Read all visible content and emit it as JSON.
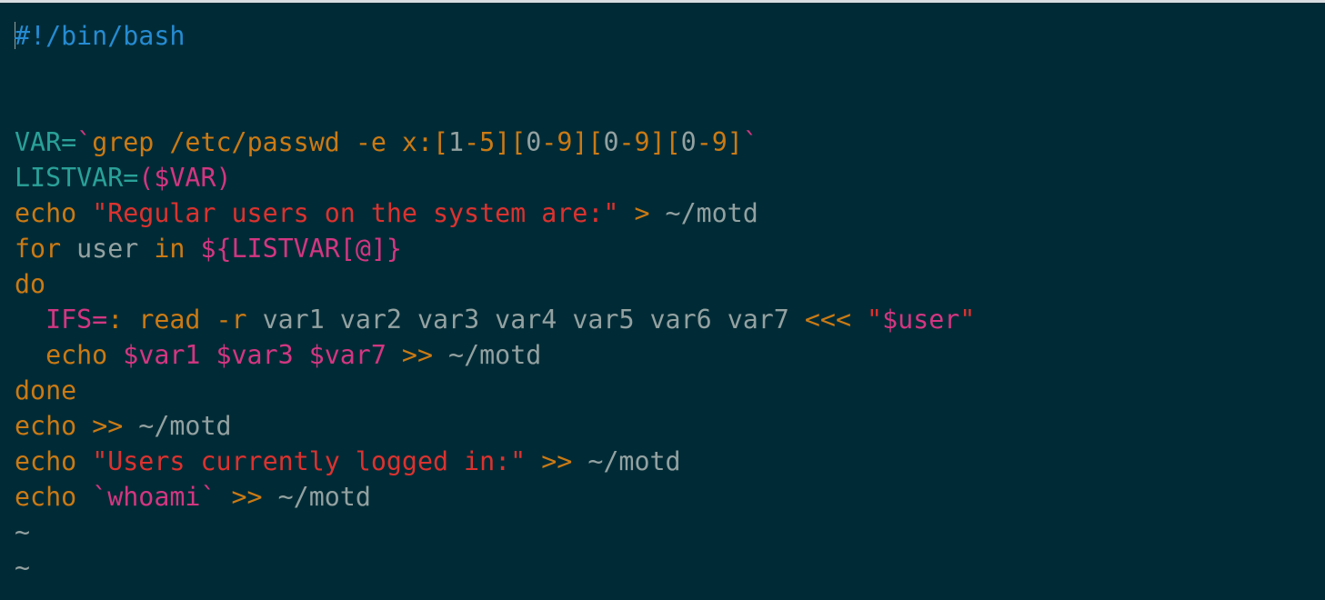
{
  "colors": {
    "background": "#002b36",
    "default": "#93a1a1",
    "cyan": "#2aa198",
    "blue": "#268bd2",
    "orange": "#cb7a14",
    "red": "#dc322f",
    "magenta": "#d33682",
    "tilde": "#93a1a1"
  },
  "editor": {
    "lines": [
      {
        "tokens": [
          {
            "t": "#!/bin/bash",
            "c": "blue"
          }
        ]
      },
      {
        "tokens": []
      },
      {
        "tokens": []
      },
      {
        "tokens": [
          {
            "t": "VAR=",
            "c": "cyan"
          },
          {
            "t": "`",
            "c": "magenta"
          },
          {
            "t": "grep /etc/passwd -e x:",
            "c": "orange"
          },
          {
            "t": "[",
            "c": "orange"
          },
          {
            "t": "1",
            "c": "default"
          },
          {
            "t": "-5][",
            "c": "orange"
          },
          {
            "t": "0",
            "c": "default"
          },
          {
            "t": "-9][",
            "c": "orange"
          },
          {
            "t": "0",
            "c": "default"
          },
          {
            "t": "-9][",
            "c": "orange"
          },
          {
            "t": "0",
            "c": "default"
          },
          {
            "t": "-9]",
            "c": "orange"
          },
          {
            "t": "`",
            "c": "magenta"
          }
        ]
      },
      {
        "tokens": [
          {
            "t": "LISTVAR=",
            "c": "cyan"
          },
          {
            "t": "($VAR)",
            "c": "magenta"
          }
        ]
      },
      {
        "tokens": [
          {
            "t": "echo ",
            "c": "orange"
          },
          {
            "t": "\"Regular users on the system are:\"",
            "c": "red"
          },
          {
            "t": " > ",
            "c": "orange"
          },
          {
            "t": "~/motd",
            "c": "default"
          }
        ]
      },
      {
        "tokens": [
          {
            "t": "for",
            "c": "orange"
          },
          {
            "t": " user ",
            "c": "default"
          },
          {
            "t": "in",
            "c": "orange"
          },
          {
            "t": " ",
            "c": "default"
          },
          {
            "t": "${LISTVAR[@]}",
            "c": "magenta"
          }
        ]
      },
      {
        "tokens": [
          {
            "t": "do",
            "c": "orange"
          }
        ]
      },
      {
        "tokens": [
          {
            "t": "  ",
            "c": "default"
          },
          {
            "t": "IFS=",
            "c": "magenta"
          },
          {
            "t": ": ",
            "c": "orange"
          },
          {
            "t": "read -r",
            "c": "orange"
          },
          {
            "t": " var1 var2 var3 var4 var5 var6 var7 ",
            "c": "default"
          },
          {
            "t": "<<< ",
            "c": "orange"
          },
          {
            "t": "\"",
            "c": "red"
          },
          {
            "t": "$user",
            "c": "magenta"
          },
          {
            "t": "\"",
            "c": "red"
          }
        ]
      },
      {
        "tokens": [
          {
            "t": "  ",
            "c": "default"
          },
          {
            "t": "echo ",
            "c": "orange"
          },
          {
            "t": "$var1 $var3 $var7",
            "c": "magenta"
          },
          {
            "t": " >> ",
            "c": "orange"
          },
          {
            "t": "~/motd",
            "c": "default"
          }
        ]
      },
      {
        "tokens": [
          {
            "t": "done",
            "c": "orange"
          }
        ]
      },
      {
        "tokens": [
          {
            "t": "echo ",
            "c": "orange"
          },
          {
            "t": ">> ",
            "c": "orange"
          },
          {
            "t": "~/motd",
            "c": "default"
          }
        ]
      },
      {
        "tokens": [
          {
            "t": "echo ",
            "c": "orange"
          },
          {
            "t": "\"Users currently logged in:\"",
            "c": "red"
          },
          {
            "t": " >> ",
            "c": "orange"
          },
          {
            "t": "~/motd",
            "c": "default"
          }
        ]
      },
      {
        "tokens": [
          {
            "t": "echo ",
            "c": "orange"
          },
          {
            "t": "`whoami`",
            "c": "magenta"
          },
          {
            "t": " >> ",
            "c": "orange"
          },
          {
            "t": "~/motd",
            "c": "default"
          }
        ]
      },
      {
        "tokens": [
          {
            "t": "~",
            "c": "tilde"
          }
        ]
      },
      {
        "tokens": [
          {
            "t": "~",
            "c": "tilde"
          }
        ]
      },
      {
        "tokens": [
          {
            "t": "~",
            "c": "tilde"
          }
        ]
      }
    ]
  }
}
